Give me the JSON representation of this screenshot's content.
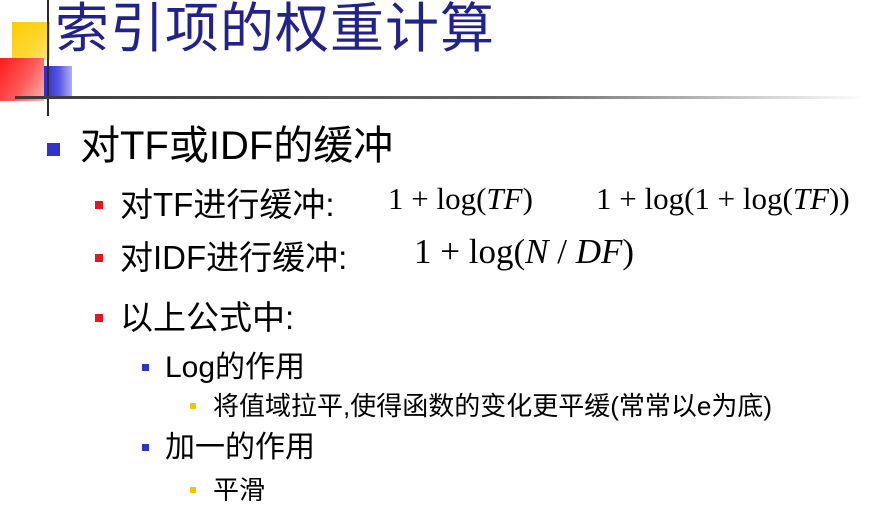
{
  "title": "索引项的权重计算",
  "bullets": {
    "level1": "对TF或IDF的缓冲",
    "tf_buffer": {
      "label": "对TF进行缓冲:",
      "formula_a": [
        "1 + log(",
        "TF",
        ")"
      ],
      "formula_b": [
        "1 + log(1 + log(",
        "TF",
        "))"
      ]
    },
    "idf_buffer": {
      "label": "对IDF进行缓冲:",
      "formula": [
        "1 + log(",
        "N",
        " / ",
        "DF",
        ")"
      ]
    },
    "note": "以上公式中:",
    "log_role": "Log的作用",
    "log_detail": "将值域拉平,使得函数的变化更平缓(常常以e为底)",
    "plus_one_role": "加一的作用",
    "plus_one_detail": "平滑"
  },
  "colors": {
    "title": "#22228a",
    "bullet_level1": "#3333cc",
    "bullet_level2": "#e8141e",
    "bullet_level3": "#3333cc",
    "bullet_level4": "#f5c400",
    "deco_yellow": "#ffcc00",
    "deco_red": "#ff1a1a",
    "deco_blue": "#2a2ad0"
  }
}
